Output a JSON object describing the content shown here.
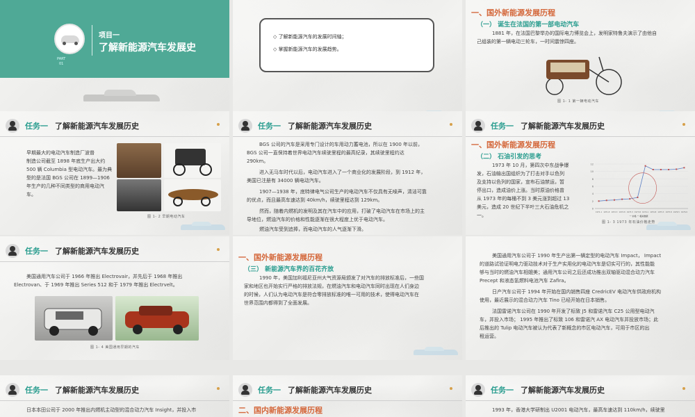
{
  "common": {
    "task_label": "任务一",
    "task_title": "了解新能源汽车发展历史"
  },
  "s1": {
    "subtitle": "项目一",
    "title": "了解新能源汽车发展史",
    "part_label": "PART",
    "part_num": "01"
  },
  "s2": {
    "bullets": [
      "◇ 了解新能源汽车的发展时间轴；",
      "◇ 掌握新能源汽车的发展趋势。"
    ]
  },
  "s3": {
    "h1": "一、国外新能源发展历程",
    "h2": "（一） 诞生在法国的第一部电动汽车",
    "p": [
      "1881 年，在法国巴黎举办的国际电力博览会上，发明家特鲁夫演示了由他自",
      "己组装的第一辆电动三轮车，一时间震惊四座。"
    ],
    "caption": "图 1- 1  第一辆电动汽车"
  },
  "s4": {
    "p": [
      "早期最大的电动汽车制造厂波普",
      "制造公司截至 1898 年底生产出大约",
      "500 辆 Columbia 型电动汽车。最为典",
      "型的是法国 BGS 公司在 1899—1906",
      "年生产的几种不同类型的商用电动汽",
      "车。"
    ],
    "caption": "图 1- 2  早期电动汽车"
  },
  "s5": {
    "p": [
      "BGS 公司的汽车是采用专门设计的车用动力蓄电池，所以在 1900 年以前，",
      "BGS 公司一直保持着世界电动汽车续驶里程的最高纪录，其续驶里程约达",
      "290km。",
      "进入无马车时代以后，电动汽车进入了一个商业化的发展阶段，到 1912 年，",
      "美国已注册有 34000 辆电动汽车。",
      "1907—1938 年，底特律电气公司生产的电动汽车不仅具有无噪声，清洁可靠",
      "的优点，而且最高车速达到 40km/h，续驶里程达到 129km。",
      "然而，随着内燃机的发明及其在汽车中的应用，打破了电动汽车在市场上的主",
      "导地位，燃油汽车的价格和性能逐渐在很大程度上优于电动汽车。",
      "燃油汽车受到追捧，而电动汽车的人气逐渐下滑。"
    ]
  },
  "s6": {
    "h1": "一、国外新能源发展历程",
    "h2": "（二） 石油引发的思考",
    "p": [
      "1973 年 10 月，第四次中东战争爆",
      "发，石油输出国组织为了打击对手以色列",
      "及支持以色列的国家，宣布石油禁运，暂",
      "停出口，造成油价上涨。当时原油价格曾",
      "从 1973 年的每桶不到 3 美元涨到超过 13",
      "美元，造成 20 世纪下半叶三大石油危机之",
      "一。"
    ],
    "caption": "图 1- 3  1973 年石油价格走势",
    "legend": [
      "一 价格",
      "一 相关数据"
    ]
  },
  "s7": {
    "p": [
      "美国通用汽车公司于 1966 年推出 Electrovair，并先后于 1968 年推出",
      "Electrovan、于 1969 年推出 Series 512 和于 1979 年推出 Electrvelt。"
    ],
    "caption": "图 1- 4  美国通用早期的汽车"
  },
  "s8": {
    "h1": "一、国外新能源发展历程",
    "h2": "（三） 新能源汽车界的百花齐放",
    "p": [
      "1990 年，美国加利福尼亚州大气资源局颁发了对汽车的排放标准后，一些国",
      "家和地区也开始实行严格的排放法规，在燃油汽车和电动汽车同时出现在人们身边",
      "的时候，人们认为电动汽车是符合零排放标准的唯一可用的技术，使得电动汽车在",
      "世界范围内都得到了全面发展。"
    ]
  },
  "s9": {
    "p": [
      "美国通用汽车公司于 1990 年生产出第一辆定型的电动汽车 Impact， Impact",
      "的道路试验证明电力驱动技术对于生产实用化的电动汽车是切实可行的，其性能能",
      "够与当时的燃油汽车相媲美；通用汽车公司之后还成功推出双轴驱动混合动力汽车",
      "Precept 和液态氢燃料电池汽车 Zafira。",
      "日产汽车公司于 1994 年开始在国内销售四座 CredricEV 电动汽车供政府机构",
      "使用，最近展示的混合动力汽车 Tino 已经开始在日本销售。",
      "法国雷诺汽车公司在 1990 年开发了标致 J5 和雷诺汽车 C25 公用型电动汽",
      "车，并投入市场； 1995 年推出了标致 106 和雷诺汽 AX 电动汽车并投放市场；此",
      "后推出的 Tulip 电动汽车被认为代表了新概念的市区电动汽车，可用于市区的出",
      "租运营。"
    ]
  },
  "s10": {
    "p": [
      "日本本田公司于 2000 年推出内燃机主动型的混合动力汽车 Insight，并投入市"
    ]
  },
  "s11": {
    "h1": "二、国内新能源发展历程"
  },
  "s12": {
    "p": [
      "1993 年，香港大学研制出 U2001 电动汽车，最高车速达到 110km/h，续驶里"
    ]
  },
  "chart_data": {
    "type": "line",
    "x": [
      "1971.1",
      "1971.8",
      "1972.3",
      "1972.8",
      "1973.3",
      "1973.8",
      "1974.1",
      "1974.8",
      "1975.3",
      "1975.8",
      "1976.5",
      "1976.9"
    ],
    "series": [
      {
        "name": "价格",
        "values": [
          2.0,
          2.2,
          2.3,
          2.5,
          2.6,
          3.0,
          11.5,
          10.5,
          10.5,
          10.5,
          10.6,
          11.0
        ]
      }
    ],
    "ylim": [
      0,
      12
    ],
    "y_ticks": [
      0,
      2,
      4,
      6,
      8,
      10,
      12
    ]
  }
}
